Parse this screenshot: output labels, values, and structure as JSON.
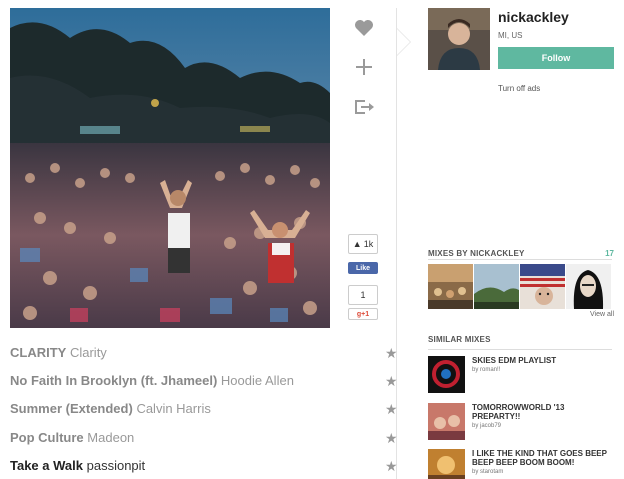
{
  "user": {
    "username": "nickackley",
    "location": "MI, US",
    "follow_label": "Follow",
    "turn_off_ads": "Turn off ads"
  },
  "social": {
    "fb_count": "1k",
    "fb_like_label": "Like",
    "gplus_count": "1",
    "gplus_label": "g+1"
  },
  "mixes_by": {
    "heading": "MIXES BY NICKACKLEY",
    "count": "17",
    "view_all": "View all",
    "thumbs": [
      "festival-crowd",
      "landscape",
      "flag",
      "portrait"
    ]
  },
  "similar_mixes": {
    "heading": "SIMILAR MIXES",
    "items": [
      {
        "title": "SKIES EDM PLAYLIST",
        "by": "by roman!!"
      },
      {
        "title": "TOMORROWWORLD '13 PREPARTY!!",
        "by": "by jacob79"
      },
      {
        "title": "I LIKE THE KIND THAT GOES BEEP BEEP BEEP BOOM BOOM!",
        "by": "by starotam"
      }
    ]
  },
  "tracks": [
    {
      "song": "CLARITY",
      "artist": "Clarity"
    },
    {
      "song": "No Faith In Brooklyn (ft. Jhameel)",
      "artist": "Hoodie Allen"
    },
    {
      "song": "Summer (Extended)",
      "artist": "Calvin Harris"
    },
    {
      "song": "Pop Culture",
      "artist": "Madeon"
    },
    {
      "song": "Take a Walk",
      "artist": "passionpit"
    }
  ],
  "colors": {
    "accent": "#5fb8a0",
    "facebook": "#4a67a9",
    "gplus": "#dd4b39"
  },
  "icons": {
    "like": "heart-icon",
    "add": "plus-icon",
    "share": "share-icon",
    "star": "star-icon"
  }
}
